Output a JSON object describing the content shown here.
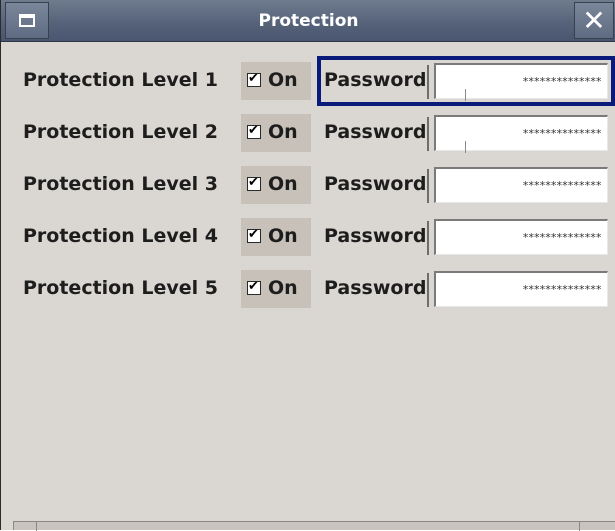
{
  "window": {
    "title": "Protection",
    "menu_icon": "window-menu-icon",
    "close_icon": "close-icon",
    "close_glyph": "✕"
  },
  "levels": [
    {
      "label": "Protection Level 1",
      "on_label": "On",
      "checked": true,
      "password_label": "Password",
      "password_value": "**************",
      "focused": true
    },
    {
      "label": "Protection Level 2",
      "on_label": "On",
      "checked": true,
      "password_label": "Password",
      "password_value": "**************",
      "focused": false
    },
    {
      "label": "Protection Level 3",
      "on_label": "On",
      "checked": true,
      "password_label": "Password",
      "password_value": "**************",
      "focused": false
    },
    {
      "label": "Protection Level 4",
      "on_label": "On",
      "checked": true,
      "password_label": "Password",
      "password_value": "**************",
      "focused": false
    },
    {
      "label": "Protection Level 5",
      "on_label": "On",
      "checked": true,
      "password_label": "Password",
      "password_value": "**************",
      "focused": false
    }
  ],
  "colors": {
    "background": "#dad6d1",
    "titlebar": "#5e6b82",
    "focus": "#0a1a7a"
  }
}
